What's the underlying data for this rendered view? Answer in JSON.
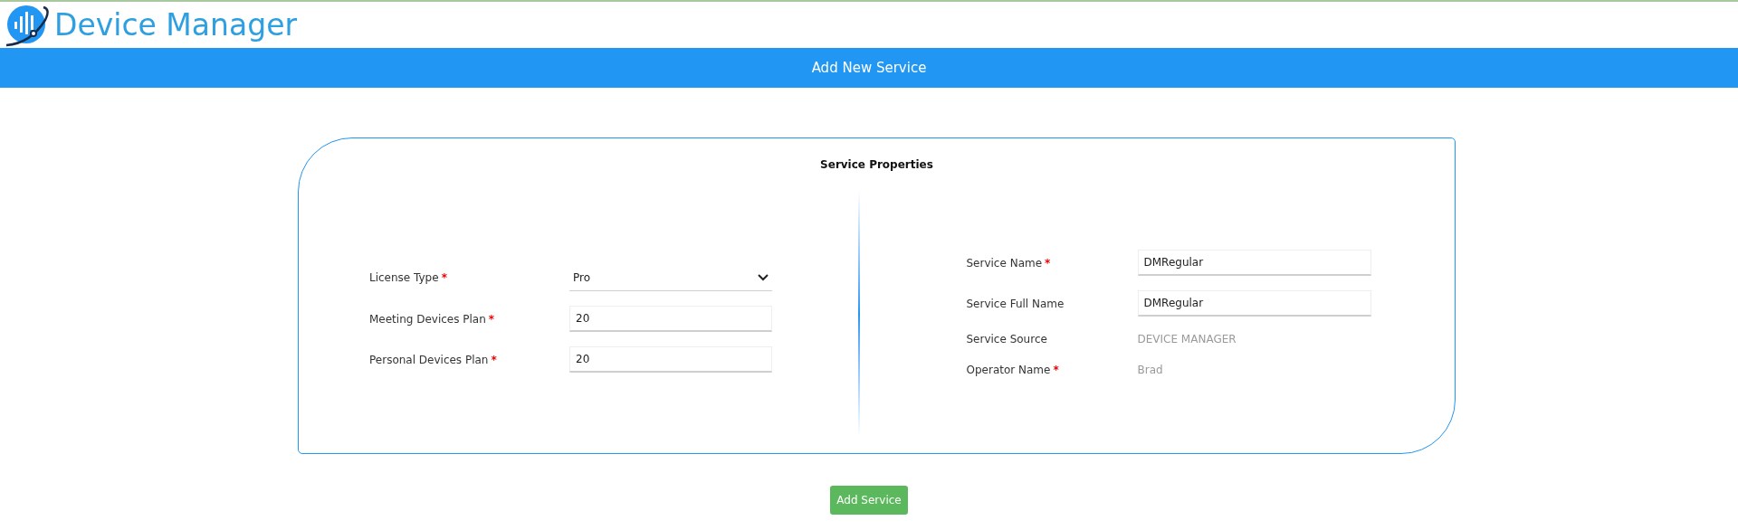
{
  "header": {
    "title": "Device Manager"
  },
  "banner": {
    "title": "Add New Service"
  },
  "card": {
    "title": "Service Properties",
    "left_fields": [
      {
        "kind": "select",
        "label": "License Type",
        "required_mark": "*",
        "value": "Pro"
      },
      {
        "kind": "input",
        "label": "Meeting Devices Plan",
        "required_mark": "*",
        "value": "20"
      },
      {
        "kind": "input",
        "label": "Personal Devices Plan",
        "required_mark": "*",
        "value": "20"
      }
    ],
    "right_fields": [
      {
        "kind": "input",
        "label": "Service Name",
        "required_mark": "*",
        "value": "DMRegular"
      },
      {
        "kind": "input",
        "label": "Service Full Name",
        "value": "DMRegular"
      },
      {
        "kind": "text",
        "label": "Service Source",
        "value": "DEVICE MANAGER"
      },
      {
        "kind": "text",
        "label": "Operator Name",
        "required_mark": "*",
        "value": "Brad"
      }
    ]
  },
  "submit_button": "Add Service"
}
